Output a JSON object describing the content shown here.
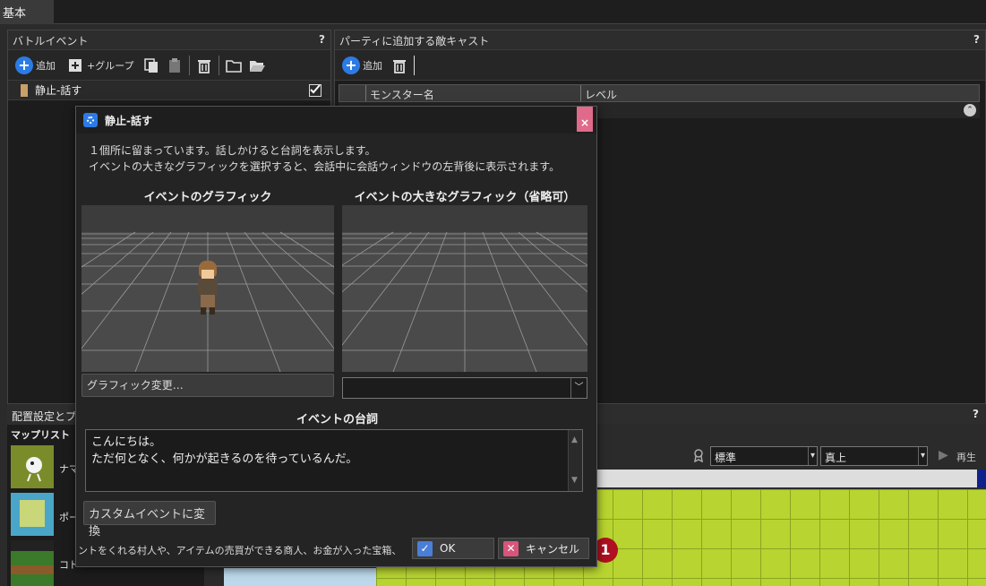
{
  "top_tab": "基本",
  "battle_event_panel": {
    "title": "バトルイベント",
    "help": "?",
    "toolbar": {
      "add_label": "追加",
      "add_group_label": "+グループ"
    },
    "list": [
      {
        "label": "静止-話す"
      }
    ]
  },
  "enemy_cast_panel": {
    "title": "パーティに追加する敵キャスト",
    "help": "?",
    "toolbar": {
      "add_label": "追加"
    },
    "columns": [
      "モンスター名",
      "レベル"
    ]
  },
  "placement_panel": {
    "title": "配置設定とプ",
    "help": "?"
  },
  "map_list": {
    "title": "マップリスト",
    "items": [
      {
        "label": "ナマ"
      },
      {
        "label": "ポー"
      },
      {
        "label": "コド"
      }
    ]
  },
  "map_toolbar": {
    "mode_select": "標準",
    "view_select": "真上",
    "play_label": "再生"
  },
  "dialog": {
    "title": "静止-話す",
    "close": "×",
    "description_line1": "１個所に留まっています。話しかけると台詞を表示します。",
    "description_line2": "イベントの大きなグラフィックを選択すると、会話中に会話ウィンドウの左背後に表示されます。",
    "graphic_label": "イベントのグラフィック",
    "big_graphic_label": "イベントの大きなグラフィック（省略可）",
    "change_graphic_button": "グラフィック変更…",
    "big_graphic_select": "",
    "dialogue_label": "イベントの台詞",
    "dialogue_line1": "こんにちは。",
    "dialogue_line2": "ただ何となく、何かが起きるのを待っているんだ。",
    "convert_button": "カスタムイベントに変換",
    "footer_hint": "ントをくれる村人や、アイテムの売買ができる商人、お金が入った宝箱、",
    "ok_button": "OK",
    "cancel_button": "キャンセル"
  },
  "colors": {
    "accent_blue": "#2c7be5",
    "close_pink": "#e06a8a",
    "map_green": "#b8d430"
  }
}
